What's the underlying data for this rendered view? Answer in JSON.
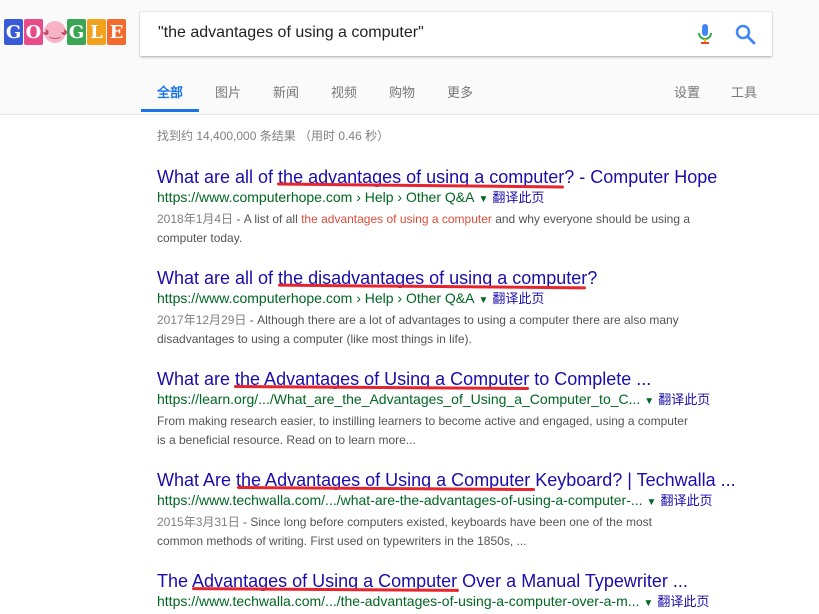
{
  "colors": {
    "accent": "#1a73e8",
    "link": "#1a0dab",
    "url": "#006621",
    "highlight_underline": "#e8242c"
  },
  "logo": {
    "letters": [
      "G",
      "O",
      "",
      "G",
      "L",
      "E"
    ],
    "mascot_icon": "baby-face-icon"
  },
  "search": {
    "query": "\"the advantages of using a computer\""
  },
  "tabs": {
    "all": "全部",
    "images": "图片",
    "news": "新闻",
    "videos": "视频",
    "shopping": "购物",
    "more": "更多",
    "settings": "设置",
    "tools": "工具"
  },
  "stats": "找到约 14,400,000 条结果 （用时 0.46 秒）",
  "results": [
    {
      "title": "What are all of the advantages of using a computer? - Computer Hope",
      "url": "https://www.computerhope.com › Help › Other Q&A",
      "translate": "翻译此页",
      "date": "2018年1月4日",
      "snippet_pre": " - A list of all ",
      "snippet_hl": "the advantages of using a computer",
      "snippet_post": " and why everyone should be using a computer today."
    },
    {
      "title": "What are all of the disadvantages of using a computer?",
      "url": "https://www.computerhope.com › Help › Other Q&A",
      "translate": "翻译此页",
      "date": "2017年12月29日",
      "snippet": " - Although there are a lot of advantages to using a computer there are also many disadvantages to using a computer (like most things in life)."
    },
    {
      "title": "What are the Advantages of Using a Computer to Complete ...",
      "url": "https://learn.org/.../What_are_the_Advantages_of_Using_a_Computer_to_C...",
      "translate": "翻译此页",
      "snippet": "From making research easier, to instilling learners to become active and engaged, using a computer is a beneficial resource. Read on to learn more..."
    },
    {
      "title": "What Are the Advantages of Using a Computer Keyboard? | Techwalla ...",
      "url": "https://www.techwalla.com/.../what-are-the-advantages-of-using-a-computer-...",
      "translate": "翻译此页",
      "date": "2015年3月31日",
      "snippet": " - Since long before computers existed, keyboards have been one of the most common methods of writing. First used on typewriters in the 1850s, ..."
    },
    {
      "title": "The Advantages of Using a Computer Over a Manual Typewriter ...",
      "url": "https://www.techwalla.com/.../the-advantages-of-using-a-computer-over-a-m...",
      "translate": "翻译此页"
    }
  ]
}
